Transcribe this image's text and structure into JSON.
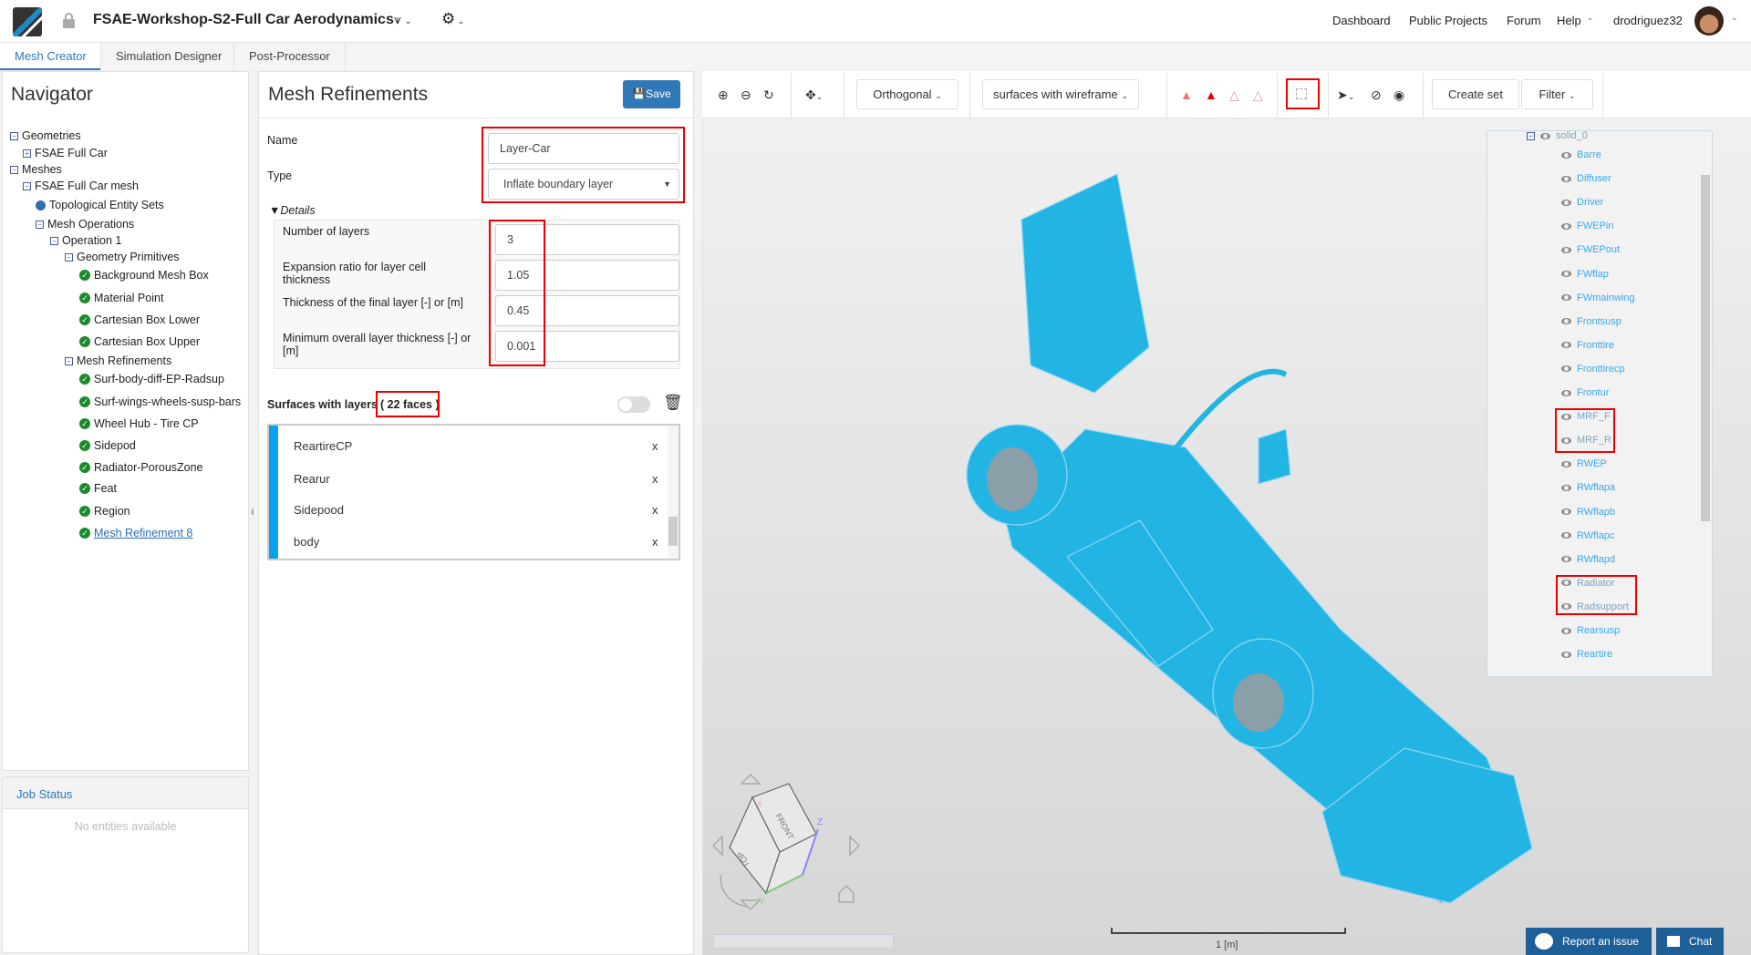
{
  "header": {
    "project_title": "FSAE-Workshop-S2-Full Car Aerodynamics",
    "nav": [
      "Dashboard",
      "Public Projects",
      "Forum",
      "Help"
    ],
    "username": "drodriguez32"
  },
  "tabs": [
    "Mesh Creator",
    "Simulation Designer",
    "Post-Processor"
  ],
  "navigator": {
    "title": "Navigator",
    "tree": [
      {
        "label": "Geometries",
        "type": "minus"
      },
      {
        "label": "FSAE Full Car",
        "type": "plus"
      },
      {
        "label": "Meshes",
        "type": "minus"
      },
      {
        "label": "FSAE Full Car mesh",
        "type": "minus"
      },
      {
        "label": "Topological Entity Sets",
        "type": "dot"
      },
      {
        "label": "Mesh Operations",
        "type": "minus"
      },
      {
        "label": "Operation 1",
        "type": "minus"
      },
      {
        "label": "Geometry Primitives",
        "type": "minus"
      },
      {
        "label": "Background Mesh Box",
        "type": "check"
      },
      {
        "label": "Material Point",
        "type": "check"
      },
      {
        "label": "Cartesian Box Lower",
        "type": "check"
      },
      {
        "label": "Cartesian Box Upper",
        "type": "check"
      },
      {
        "label": "Mesh Refinements",
        "type": "minus"
      },
      {
        "label": "Surf-body-diff-EP-Radsup",
        "type": "check"
      },
      {
        "label": "Surf-wings-wheels-susp-bars",
        "type": "check"
      },
      {
        "label": "Wheel Hub - Tire CP",
        "type": "check"
      },
      {
        "label": "Sidepod",
        "type": "check"
      },
      {
        "label": "Radiator-PorousZone",
        "type": "check"
      },
      {
        "label": "Feat",
        "type": "check"
      },
      {
        "label": "Region",
        "type": "check"
      },
      {
        "label": "Mesh Refinement 8",
        "type": "check"
      }
    ]
  },
  "job_status": {
    "title": "Job Status",
    "empty": "No entities available"
  },
  "form": {
    "title": "Mesh Refinements",
    "save": "Save",
    "name_label": "Name",
    "name_value": "Layer-Car",
    "type_label": "Type",
    "type_value": "Inflate boundary layer",
    "details": "Details",
    "fields": [
      {
        "label": "Number of layers",
        "value": "3"
      },
      {
        "label": "Expansion ratio for layer cell thickness",
        "value": "1.05"
      },
      {
        "label": "Thickness of the final layer [-] or [m]",
        "value": "0.45"
      },
      {
        "label": "Minimum overall layer thickness [-] or [m]",
        "value": "0.001"
      }
    ],
    "surfaces_label": "Surfaces with layers",
    "faces_count": "( 22 faces )",
    "surfaces": [
      "ReartireCP",
      "Rearur",
      "Sidepood",
      "body"
    ],
    "remove": "x"
  },
  "viewer": {
    "projection": "Orthogonal",
    "render_mode": "surfaces with wireframe",
    "create_set": "Create set",
    "filter": "Filter",
    "scale_label": "1 [m]",
    "report": "Report an issue",
    "chat": "Chat",
    "cube": {
      "front": "FRONT",
      "top": "TOP",
      "x": "X",
      "y": "Y",
      "z": "Z"
    },
    "solid": "solid_0",
    "faces": [
      "Barre",
      "Diffuser",
      "Driver",
      "FWEPin",
      "FWEPout",
      "FWflap",
      "FWmainwing",
      "Frontsusp",
      "Fronttire",
      "Fronttirecp",
      "Frontur",
      "MRF_F",
      "MRF_R",
      "RWEP",
      "RWflapa",
      "RWflapb",
      "RWflapc",
      "RWflapd",
      "Radiator",
      "Radsupport",
      "Rearsusp",
      "Reartire",
      "ReartireCP"
    ]
  },
  "colors": {
    "accent": "#2a7ab8",
    "model": "#22b4e3",
    "highlight": "#e00000"
  }
}
